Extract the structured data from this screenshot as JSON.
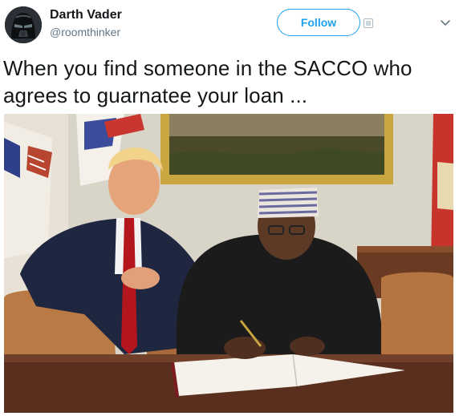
{
  "tweet": {
    "author": {
      "display_name": "Darth Vader",
      "handle": "@roomthinker",
      "avatar_icon": "darth-vader-avatar"
    },
    "follow_button_label": "Follow",
    "menu_icon": "chevron-down-icon",
    "text": "When you find someone in the SACCO who agrees to guarnatee your loan ...",
    "photo": {
      "description_icon": "photo",
      "accent_colors": {
        "wall": "#d9d4c8",
        "frame": "#c9a640",
        "desk": "#5a2f1e",
        "chair": "#b97a45"
      }
    }
  },
  "colors": {
    "accent": "#1da1f2",
    "text": "#14171a",
    "muted": "#657786"
  }
}
